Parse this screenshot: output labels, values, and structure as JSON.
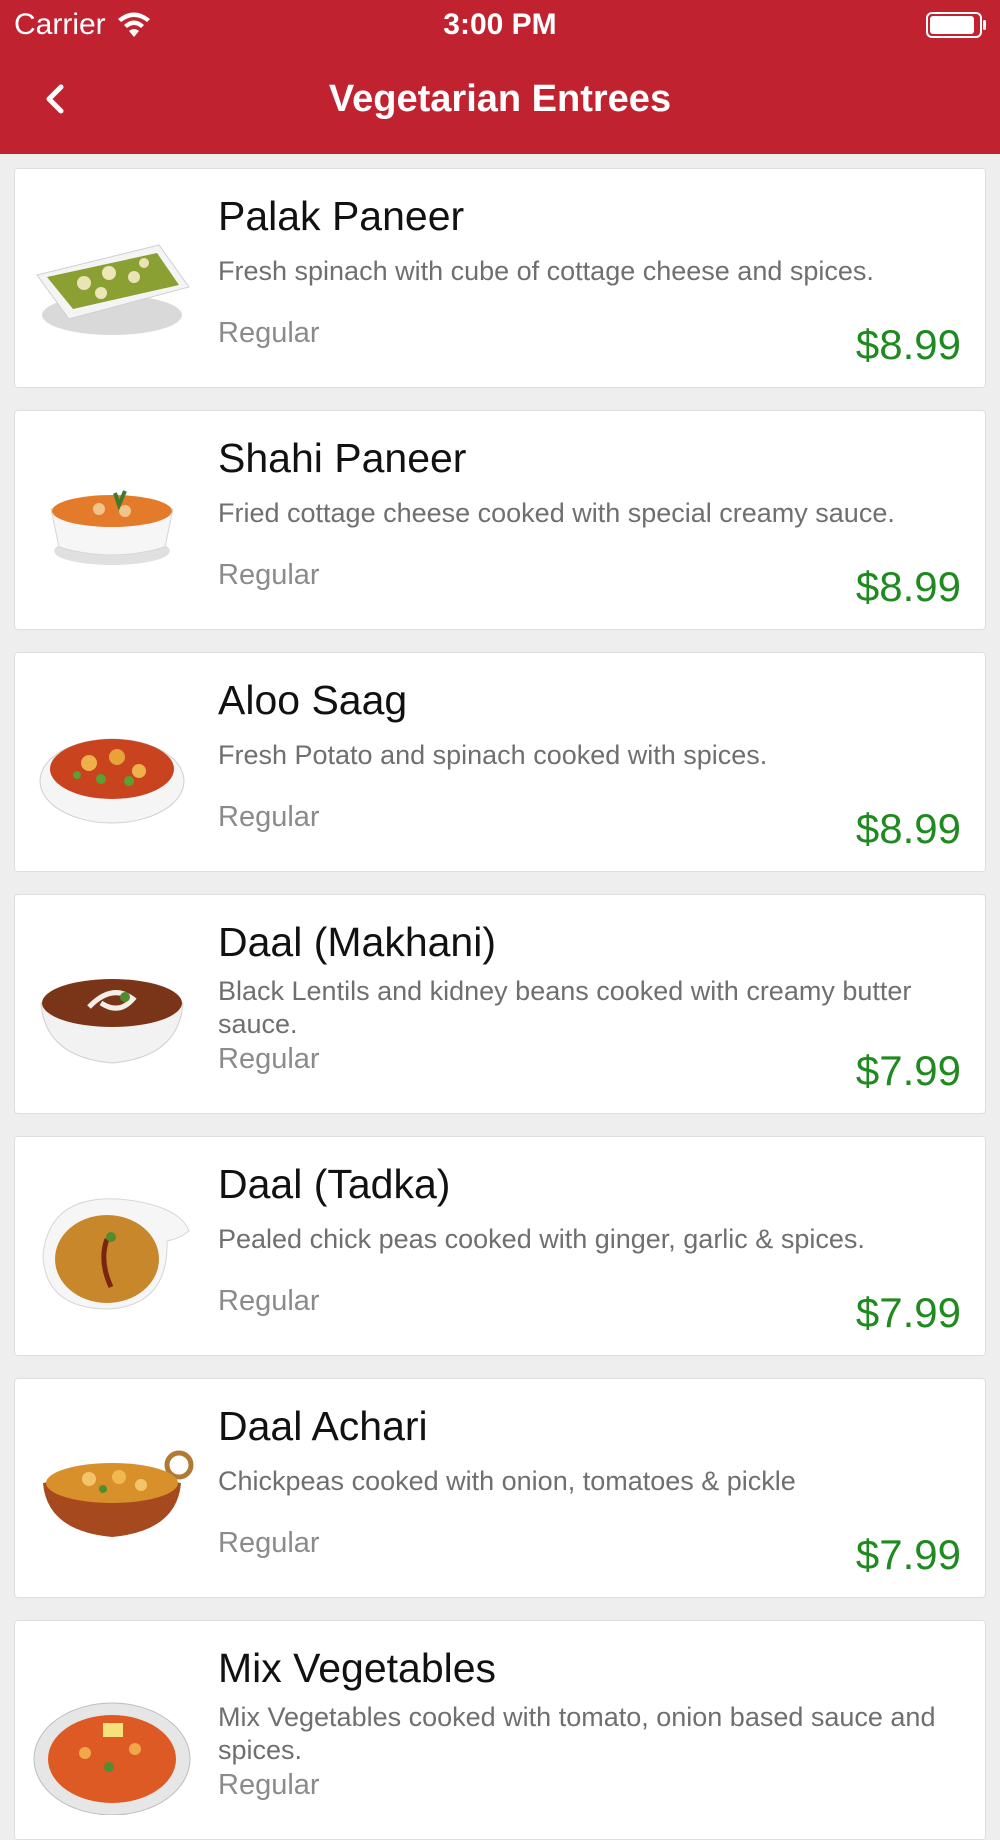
{
  "status_bar": {
    "carrier": "Carrier",
    "time": "3:00 PM"
  },
  "nav": {
    "title": "Vegetarian Entrees",
    "back_icon": "chevron-left-icon"
  },
  "colors": {
    "header": "#c12230",
    "price": "#1f8a1f"
  },
  "items": [
    {
      "name": "Palak Paneer",
      "description": "Fresh spinach with cube of cottage cheese and spices.",
      "size": "Regular",
      "price": "$8.99",
      "image": "palak-paneer-image"
    },
    {
      "name": "Shahi Paneer",
      "description": "Fried cottage cheese cooked with special creamy sauce.",
      "size": "Regular",
      "price": "$8.99",
      "image": "shahi-paneer-image"
    },
    {
      "name": "Aloo Saag",
      "description": "Fresh Potato and spinach cooked with spices.",
      "size": "Regular",
      "price": "$8.99",
      "image": "aloo-saag-image"
    },
    {
      "name": "Daal (Makhani)",
      "description": "Black Lentils and kidney beans cooked with creamy butter sauce.",
      "size": "Regular",
      "price": "$7.99",
      "image": "daal-makhani-image"
    },
    {
      "name": "Daal (Tadka)",
      "description": "Pealed chick peas cooked with ginger, garlic & spices.",
      "size": "Regular",
      "price": "$7.99",
      "image": "daal-tadka-image"
    },
    {
      "name": "Daal Achari",
      "description": "Chickpeas cooked with onion, tomatoes & pickle",
      "size": "Regular",
      "price": "$7.99",
      "image": "daal-achari-image"
    },
    {
      "name": "Mix Vegetables",
      "description": "Mix Vegetables cooked with tomato, onion based sauce and spices.",
      "size": "Regular",
      "price": "",
      "image": "mix-vegetables-image"
    }
  ]
}
